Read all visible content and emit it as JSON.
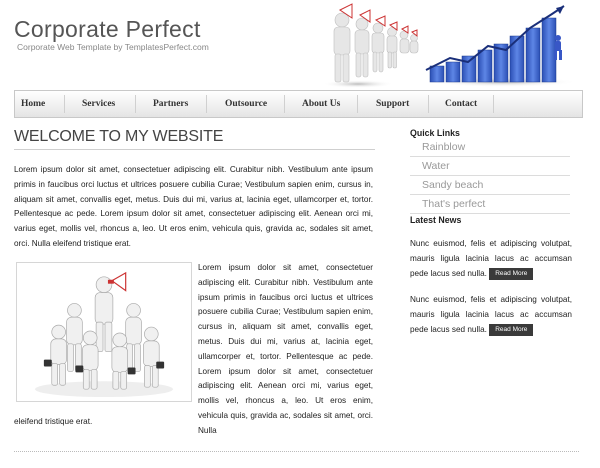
{
  "site": {
    "title": "Corporate Perfect",
    "subtitle": "Corporate Web Template by TemplatesPerfect.com"
  },
  "nav": {
    "items": [
      {
        "label": "Home"
      },
      {
        "label": "Services"
      },
      {
        "label": "Partners"
      },
      {
        "label": "Outsource"
      },
      {
        "label": "About Us"
      },
      {
        "label": "Support"
      },
      {
        "label": "Contact"
      }
    ]
  },
  "main": {
    "heading": "WELCOME TO MY WEBSITE",
    "para1": "Lorem ipsum dolor sit amet, consectetuer adipiscing elit. Curabitur nibh. Vestibulum ante ipsum primis in faucibus orci luctus et ultrices posuere cubilia Curae; Vestibulum sapien enim, cursus in, aliquam sit amet, convallis eget, metus. Duis dui mi, varius at, lacinia eget, ullamcorper et, tortor. Pellentesque ac pede. Lorem ipsum dolor sit amet, consectetuer adipiscing elit. Aenean orci mi, varius eget, mollis vel, rhoncus a, leo. Ut eros enim, vehicula quis, gravida ac, sodales sit amet, orci. Nulla eleifend tristique erat.",
    "para2": "Lorem ipsum dolor sit amet, consectetuer adipiscing elit. Curabitur nibh. Vestibulum ante ipsum primis in faucibus orci luctus et ultrices posuere cubilia Curae; Vestibulum sapien enim, cursus in, aliquam sit amet, convallis eget, metus. Duis dui mi, varius at, lacinia eget, ullamcorper et, tortor. Pellentesque ac pede. Lorem ipsum dolor sit amet, consectetuer adipiscing elit. Aenean orci mi, varius eget, mollis vel, rhoncus a, leo. Ut eros enim, vehicula quis, gravida ac, sodales sit amet, orci. Nulla",
    "para2_tail": "eleifend tristique erat."
  },
  "sidebar": {
    "quick_links_title": "Quick Links",
    "quick_links": [
      {
        "label": "Rainblow"
      },
      {
        "label": "Water"
      },
      {
        "label": "Sandy beach"
      },
      {
        "label": "That's perfect"
      }
    ],
    "latest_news_title": "Latest News",
    "news": [
      {
        "text": "Nunc euismod, felis et adipiscing volutpat, mauris ligula lacinia lacus ac accumsan pede lacus sed nulla.",
        "button": "Read More"
      },
      {
        "text": "Nunc euismod, felis et adipiscing volutpat, mauris ligula lacinia lacus ac accumsan pede lacus sed nulla.",
        "button": "Read More"
      }
    ]
  },
  "colors": {
    "accent_blue": "#3a63c8",
    "nav_text": "#333333",
    "muted_link": "#999999",
    "button_bg": "#3a3a3a"
  },
  "icons": {
    "header_people": "megaphone-people-illustration",
    "header_chart": "blue-bar-growth-chart-illustration",
    "team_photo": "business-team-illustration"
  }
}
